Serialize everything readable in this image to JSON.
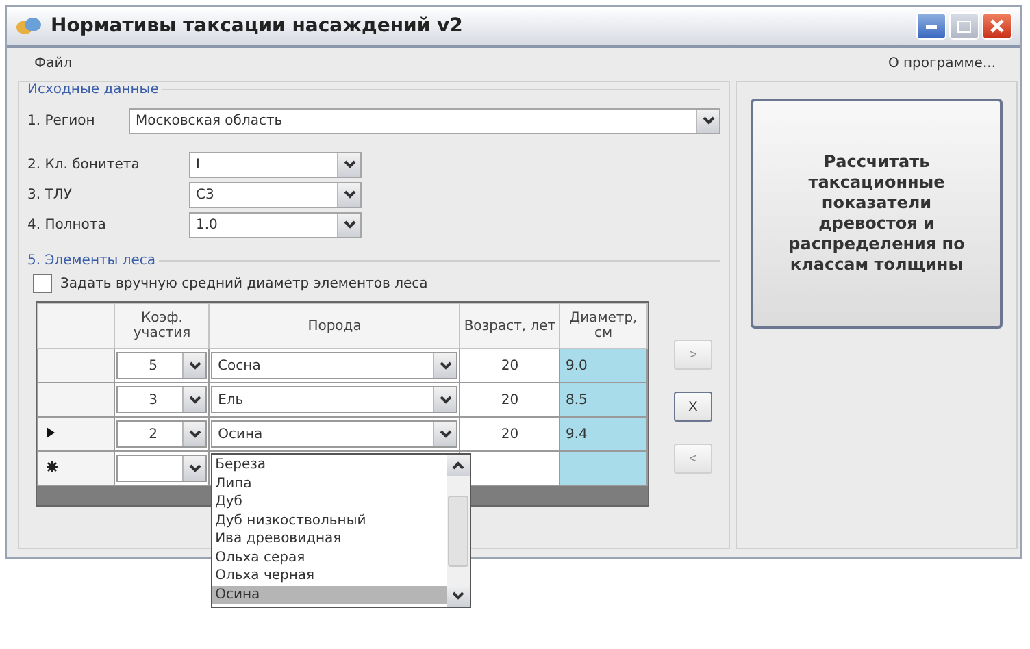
{
  "window": {
    "title": "Нормативы таксации насаждений v2"
  },
  "menu": [
    {
      "label": "Файл"
    },
    {
      "label": "О программе..."
    }
  ],
  "source_group": {
    "title": "Исходные данные",
    "fields": [
      {
        "kind": "wide",
        "label": "1. Регион",
        "value": "Московская область"
      },
      {
        "kind": "narrow",
        "label": "2. Кл. бонитета",
        "value": "I"
      },
      {
        "kind": "narrow",
        "label": "3. ТЛУ",
        "value": "С3"
      },
      {
        "kind": "narrow",
        "label": "4. Полнота",
        "value": "1.0"
      }
    ]
  },
  "calc_button": {
    "label": "Рассчитать таксационные показатели древостоя и распределения по классам толщины"
  },
  "elements_group": {
    "title": "5. Элементы леса",
    "manual_checkbox": {
      "label": "Задать вручную средний диаметр элементов леса",
      "checked": false
    },
    "columns": [
      "Коэф. участия",
      "Порода",
      "Возраст, лет",
      "Диаметр, см"
    ],
    "rows": [
      {
        "kind": "data",
        "current": false,
        "coefficient": "5",
        "species": "Сосна",
        "age": "20",
        "diameter": "9.0"
      },
      {
        "kind": "data",
        "current": false,
        "coefficient": "3",
        "species": "Ель",
        "age": "20",
        "diameter": "8.5"
      },
      {
        "kind": "data",
        "current": true,
        "coefficient": "2",
        "species": "Осина",
        "age": "20",
        "diameter": "9.4"
      },
      {
        "kind": "new"
      }
    ],
    "species_list": {
      "items": [
        {
          "label": "Береза",
          "selected": false
        },
        {
          "label": "Липа",
          "selected": false
        },
        {
          "label": "Дуб",
          "selected": false
        },
        {
          "label": "Дуб низкоствольный",
          "selected": false
        },
        {
          "label": "Ива древовидная",
          "selected": false
        },
        {
          "label": "Ольха серая",
          "selected": false
        },
        {
          "label": "Ольха черная",
          "selected": false
        },
        {
          "label": "Осина",
          "selected": true
        }
      ]
    },
    "side_buttons": [
      {
        "label": ">",
        "disabled": true
      },
      {
        "label": "X",
        "disabled": false
      },
      {
        "label": "<",
        "disabled": true
      }
    ]
  }
}
